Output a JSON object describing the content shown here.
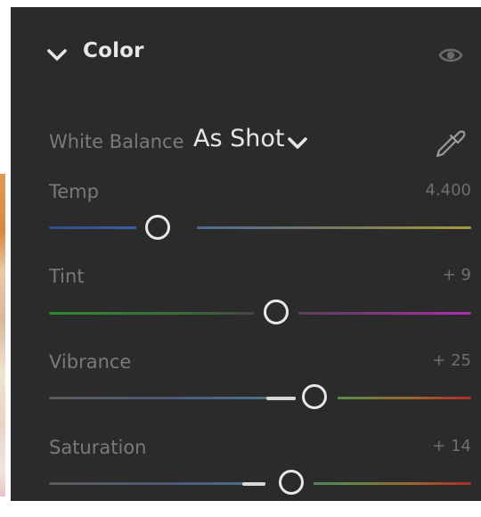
{
  "panel": {
    "title": "Color",
    "white_balance": {
      "label": "White Balance",
      "value": "As Shot"
    },
    "sliders": [
      {
        "label": "Temp",
        "value": "4.400",
        "position": 0.263
      },
      {
        "label": "Tint",
        "value": "+ 9",
        "position": 0.542
      },
      {
        "label": "Vibrance",
        "value": "+ 25",
        "position": 0.627
      },
      {
        "label": "Saturation",
        "value": "+ 14",
        "position": 0.57
      }
    ]
  },
  "colors": {
    "panel_bg": "#2b2b2b",
    "label": "#7a7a7a",
    "value": "#6e6e6e",
    "title": "#e6e6e6"
  },
  "icons": [
    "chevron-down-icon",
    "eye-icon",
    "eyedropper-icon"
  ]
}
